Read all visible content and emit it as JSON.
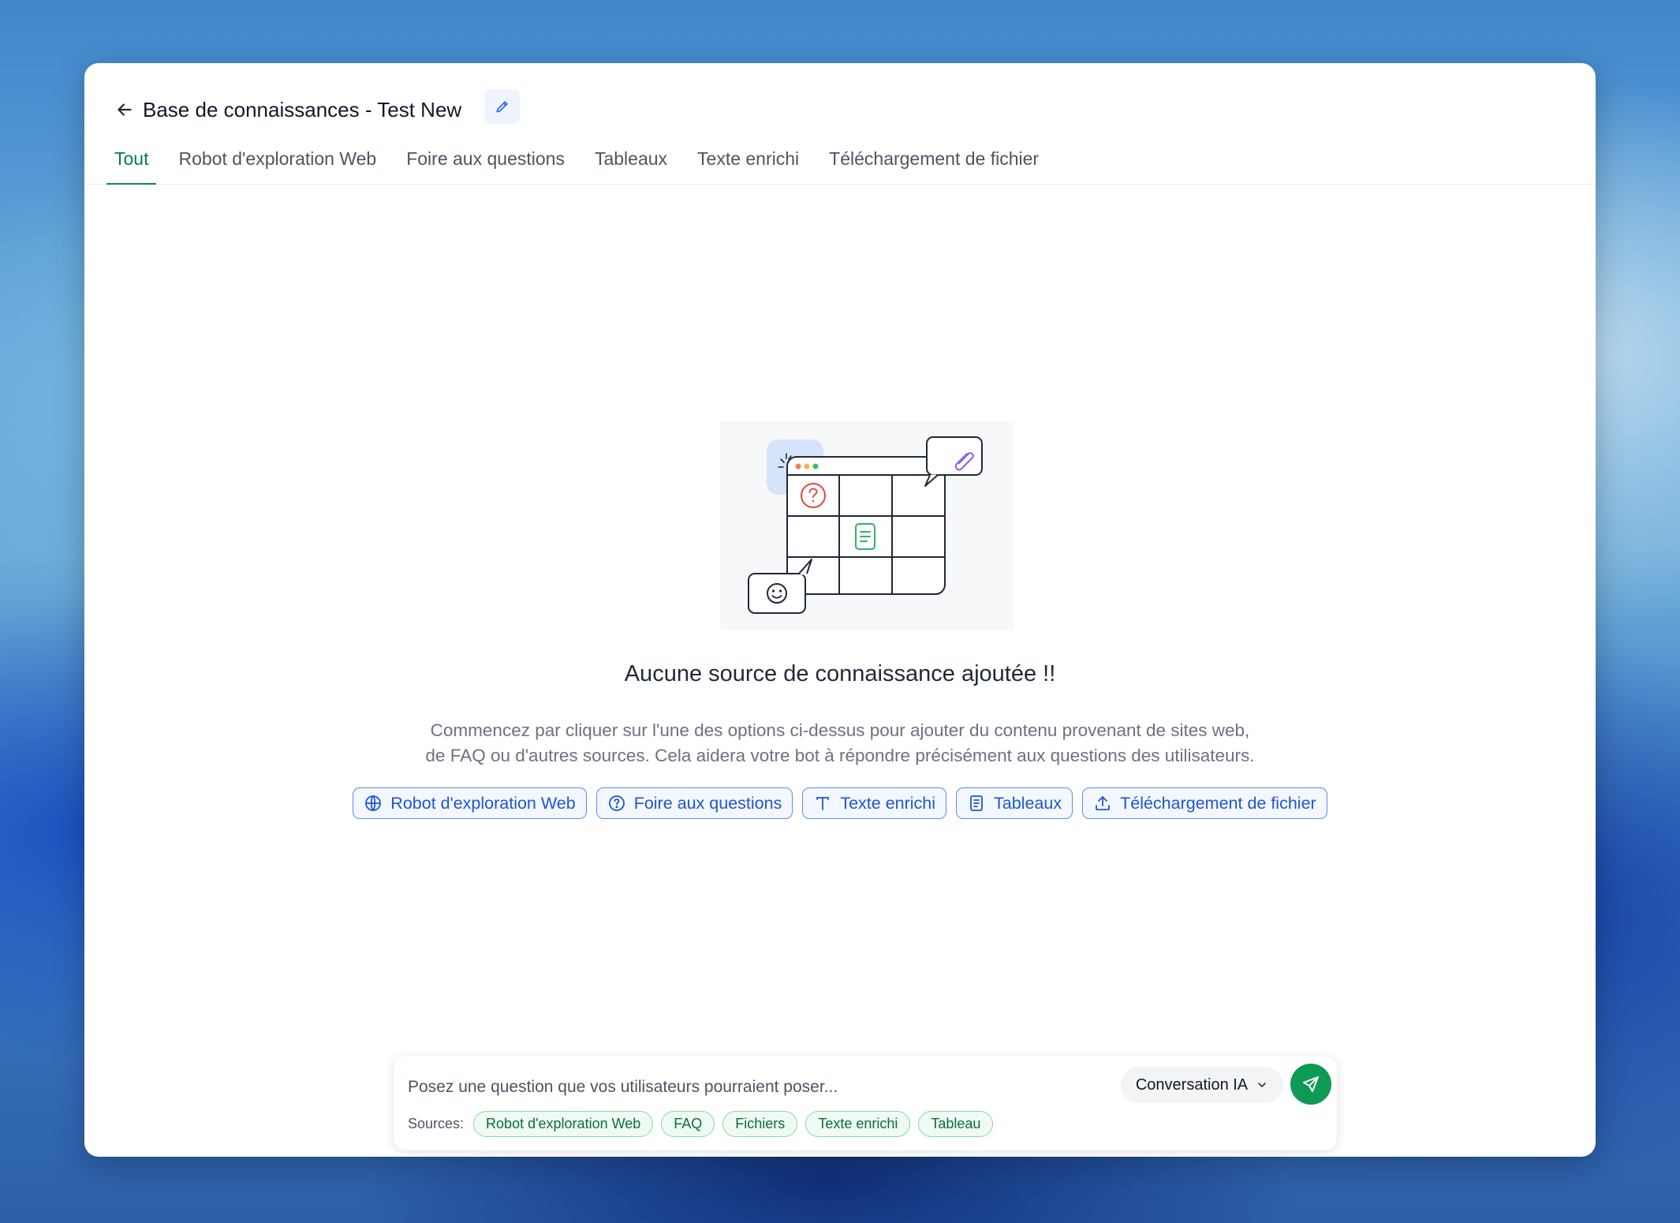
{
  "header": {
    "title": "Base de connaissances - Test New",
    "back_icon": "arrow-left-icon",
    "edit_icon": "pencil-icon"
  },
  "tabs": [
    {
      "label": "Tout",
      "active": true
    },
    {
      "label": "Robot d'exploration Web",
      "active": false
    },
    {
      "label": "Foire aux questions",
      "active": false
    },
    {
      "label": "Tableaux",
      "active": false
    },
    {
      "label": "Texte enrichi",
      "active": false
    },
    {
      "label": "Téléchargement de fichier",
      "active": false
    }
  ],
  "empty_state": {
    "title": "Aucune source de connaissance ajoutée !!",
    "description_line1": "Commencez par cliquer sur l'une des options ci-dessus pour ajouter du contenu provenant de sites web,",
    "description_line2": "de FAQ ou d'autres sources. Cela aidera votre bot à répondre précisément aux questions des utilisateurs.",
    "actions": [
      {
        "label": "Robot d'exploration Web",
        "icon": "globe-icon"
      },
      {
        "label": "Foire aux questions",
        "icon": "question-circle-icon"
      },
      {
        "label": "Texte enrichi",
        "icon": "text-icon"
      },
      {
        "label": "Tableaux",
        "icon": "document-icon"
      },
      {
        "label": "Téléchargement de fichier",
        "icon": "upload-icon"
      }
    ]
  },
  "composer": {
    "placeholder": "Posez une question que vos utilisateurs pourraient poser...",
    "mode": "Conversation IA",
    "sources_label": "Sources:",
    "sources": [
      "Robot d'exploration Web",
      "FAQ",
      "Fichiers",
      "Texte enrichi",
      "Tableau"
    ]
  },
  "colors": {
    "accent_green": "#0d9a55",
    "active_tab": "#087a4f",
    "action_blue": "#1e55d6"
  }
}
